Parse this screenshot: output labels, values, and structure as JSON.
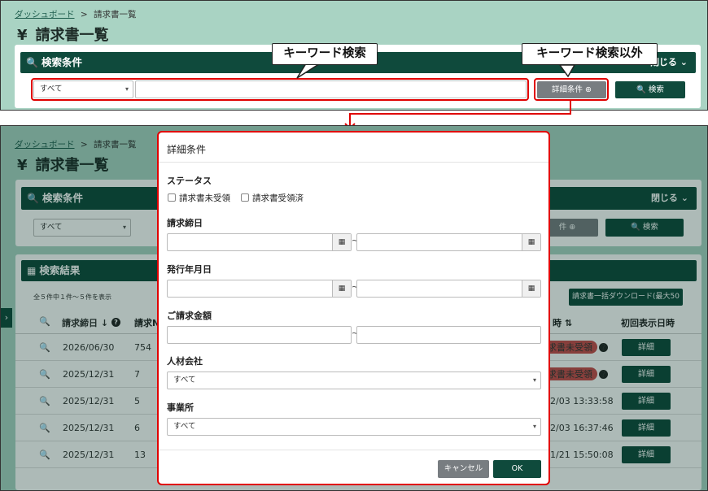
{
  "top": {
    "breadcrumb_link": "ダッシュボード",
    "breadcrumb_sep": ">",
    "breadcrumb_current": "請求書一覧",
    "title_icon": "yen-icon",
    "title": "請求書一覧",
    "search_header": "検索条件",
    "close_label": "閉じる",
    "select_value": "すべて",
    "keyword_value": "",
    "detail_button": "詳細条件",
    "search_button": "検索"
  },
  "callouts": {
    "keyword": "キーワード検索",
    "other": "キーワード検索以外"
  },
  "bottom": {
    "breadcrumb_link": "ダッシュボード",
    "breadcrumb_sep": ">",
    "breadcrumb_current": "請求書一覧",
    "title": "請求書一覧",
    "search_header": "検索条件",
    "close_label": "閉じる",
    "select_value": "すべて",
    "detail_button": "件",
    "search_button": "検索",
    "results_header": "検索結果",
    "count_text": "全５件中１件～５件を表示",
    "download_button": "請求書一括ダウンロード(最大50件)",
    "columns": {
      "closing_date": "請求締日",
      "no": "請求N",
      "time": "時",
      "first_view": "初回表示日時"
    },
    "rows": [
      {
        "date": "2026/06/30",
        "no": "754",
        "time": "",
        "badge": "求書未受領",
        "detail": "詳細"
      },
      {
        "date": "2025/12/31",
        "no": "7",
        "time": "",
        "badge": "求書未受領",
        "detail": "詳細"
      },
      {
        "date": "2025/12/31",
        "no": "5",
        "time": "2/03 13:33:58",
        "badge": "",
        "detail": "詳細"
      },
      {
        "date": "2025/12/31",
        "no": "6",
        "time": "2/03 16:37:46",
        "badge": "",
        "detail": "詳細"
      },
      {
        "date": "2025/12/31",
        "no": "13",
        "time": "1/21 15:50:08",
        "badge": "",
        "detail": "詳細"
      }
    ]
  },
  "modal": {
    "title": "詳細条件",
    "status_label": "ステータス",
    "status_opt1": "請求書未受領",
    "status_opt2": "請求書受領済",
    "closing_label": "請求締日",
    "issue_label": "発行年月日",
    "amount_label": "ご請求金額",
    "company_label": "人材会社",
    "company_value": "すべて",
    "office_label": "事業所",
    "office_value": "すべて",
    "tilde": "~",
    "cancel": "キャンセル",
    "ok": "OK"
  },
  "colors": {
    "accent": "#0f4a3c",
    "bg": "#a9d3c3",
    "highlight": "#e00000",
    "badge": "#c74b4b"
  }
}
